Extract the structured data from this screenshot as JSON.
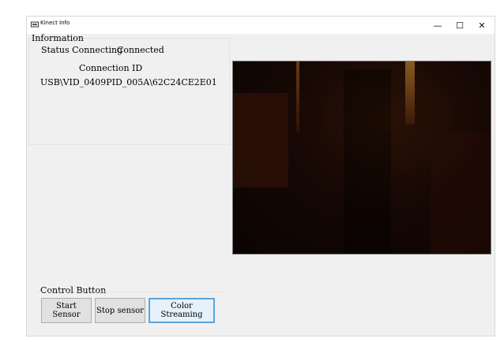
{
  "window": {
    "title": "Kinect Info",
    "controls": {
      "minimize": "—",
      "maximize": "☐",
      "close": "✕"
    }
  },
  "information": {
    "group_label": "Information",
    "status_label": "Status Connecting",
    "status_value": "Connected",
    "connection_id_label": "Connection ID",
    "connection_id_value": "USB\\VID_0409PID_005A\\62C24CE2E01"
  },
  "video_feed": {
    "description_color": "#1a0904"
  },
  "control": {
    "group_label": "Control Button",
    "buttons": [
      {
        "label": "Start Sensor"
      },
      {
        "label": "Stop sensor"
      },
      {
        "label": "Color Streaming"
      }
    ]
  }
}
